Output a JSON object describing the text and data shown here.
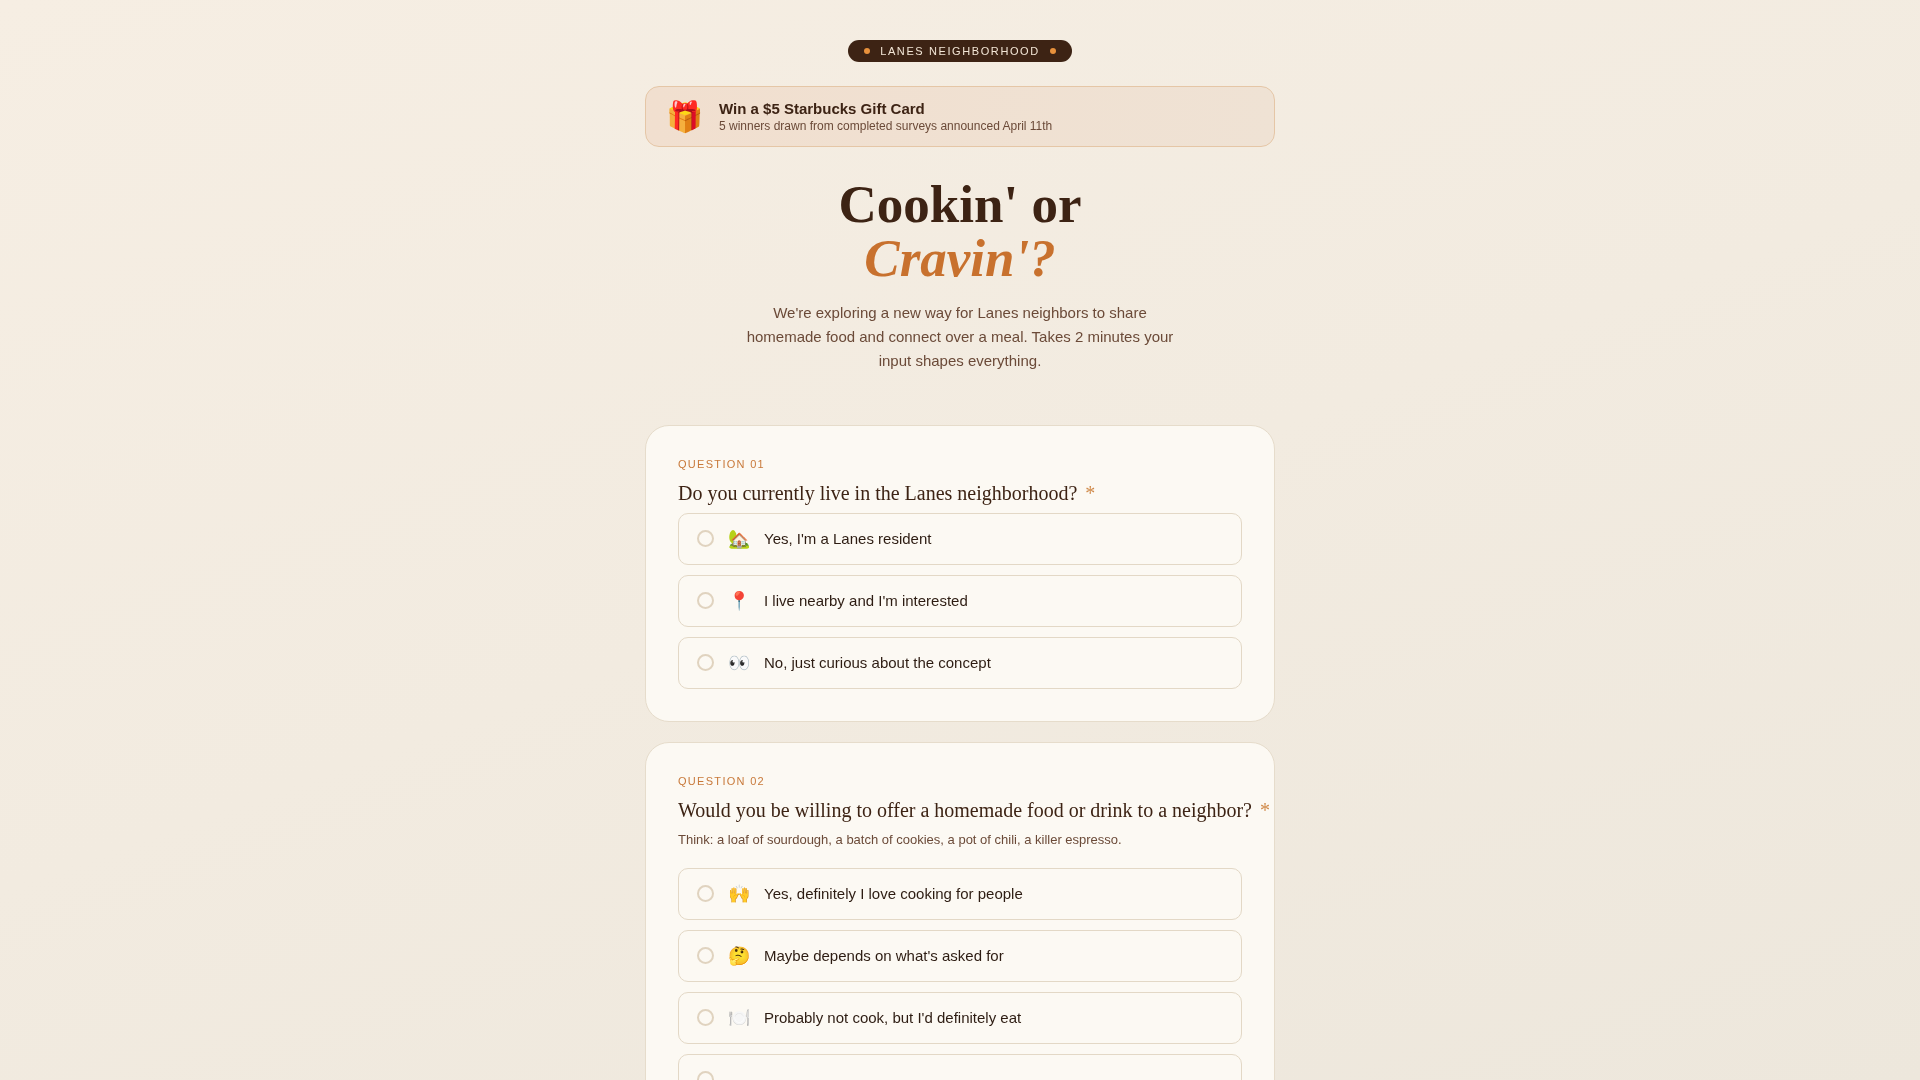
{
  "badge": {
    "label": "LANES NEIGHBORHOOD"
  },
  "banner": {
    "icon": "🎁",
    "title": "Win a $5 Starbucks Gift Card",
    "subtitle": "5 winners drawn from completed surveys announced April 11th"
  },
  "hero": {
    "title_line_1": "Cookin' or",
    "title_line_2": "Cravin'?",
    "intro": "We're exploring a new way for Lanes neighbors to share homemade food and connect over a meal. Takes 2 minutes your input shapes everything."
  },
  "questions": [
    {
      "number": "QUESTION 01",
      "text": "Do you currently live in the Lanes neighborhood?",
      "required_mark": "*",
      "options": [
        {
          "icon": "🏡",
          "label": "Yes, I'm a Lanes resident",
          "selected": false
        },
        {
          "icon": "📍",
          "label": "I live nearby and I'm interested",
          "selected": false
        },
        {
          "icon": "👀",
          "label": "No, just curious about the concept",
          "selected": false
        }
      ]
    },
    {
      "number": "QUESTION 02",
      "text": "Would you be willing to offer a homemade food or drink to a neighbor?",
      "required_mark": "*",
      "hint": "Think: a loaf of sourdough, a batch of cookies, a pot of chili, a killer espresso.",
      "options": [
        {
          "icon": "🙌",
          "label": "Yes, definitely I love cooking for people",
          "selected": false
        },
        {
          "icon": "🤔",
          "label": "Maybe depends on what's asked for",
          "selected": false
        },
        {
          "icon": "🍽️",
          "label": "Probably not cook, but I'd definitely eat",
          "selected": false
        },
        {
          "selected": false
        }
      ]
    }
  ]
}
